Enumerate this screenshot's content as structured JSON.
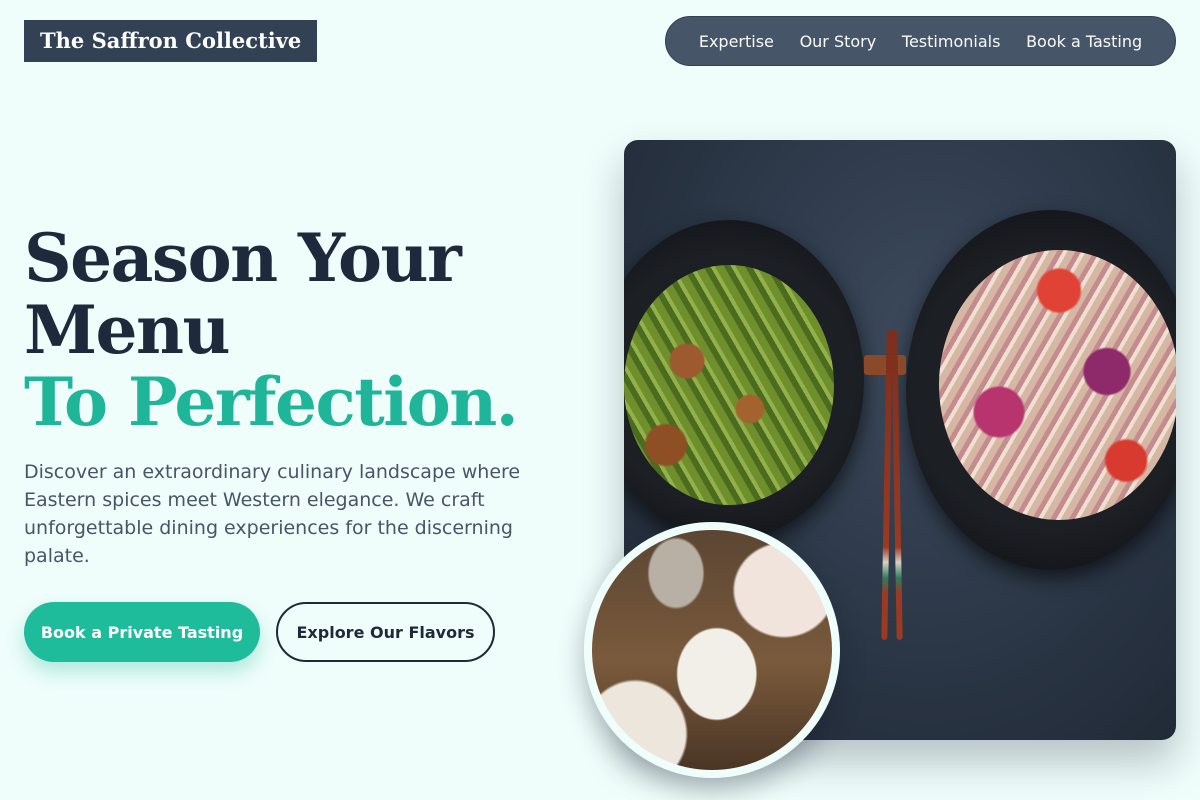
{
  "brand": {
    "name": "The Saffron Collective"
  },
  "nav": {
    "items": [
      {
        "label": "Expertise"
      },
      {
        "label": "Our Story"
      },
      {
        "label": "Testimonials"
      },
      {
        "label": "Book a Tasting"
      }
    ]
  },
  "hero": {
    "headline_line1": "Season Your",
    "headline_line2": "Menu",
    "headline_line3": "To Perfection.",
    "description": "Discover an extraordinary culinary landscape where Eastern spices meet Western elegance. We craft unforgettable dining experiences for the discerning palate.",
    "primary_button": "Book a Private Tasting",
    "secondary_button": "Explore Our Flavors"
  },
  "colors": {
    "background": "#effdfb",
    "accent": "#1fbc9c",
    "dark": "#1e293b",
    "nav_bg": "#475569"
  }
}
